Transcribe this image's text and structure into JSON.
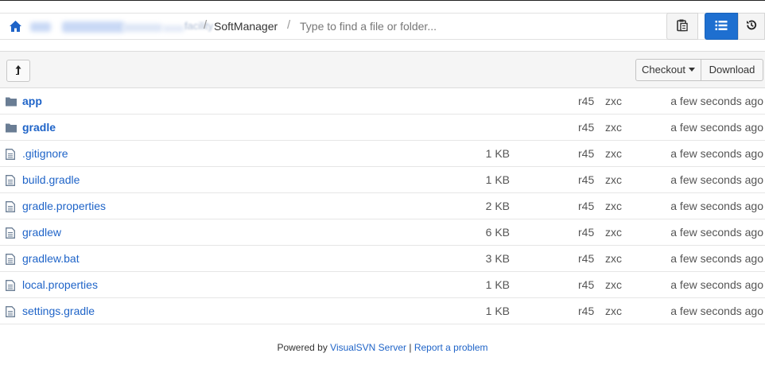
{
  "pathbar": {
    "breadcrumb_blurred": "facility",
    "separator": "/",
    "current": "SoftManager",
    "search_placeholder": "Type to find a file or folder..."
  },
  "toolbar": {
    "up_icon": "arrow-up-icon",
    "checkout_label": "Checkout",
    "download_label": "Download"
  },
  "files": [
    {
      "type": "dir",
      "name": "app",
      "size": "",
      "rev": "r45",
      "author": "zxc",
      "date": "a few seconds ago"
    },
    {
      "type": "dir",
      "name": "gradle",
      "size": "",
      "rev": "r45",
      "author": "zxc",
      "date": "a few seconds ago"
    },
    {
      "type": "file",
      "name": ".gitignore",
      "size": "1 KB",
      "rev": "r45",
      "author": "zxc",
      "date": "a few seconds ago"
    },
    {
      "type": "file",
      "name": "build.gradle",
      "size": "1 KB",
      "rev": "r45",
      "author": "zxc",
      "date": "a few seconds ago"
    },
    {
      "type": "file",
      "name": "gradle.properties",
      "size": "2 KB",
      "rev": "r45",
      "author": "zxc",
      "date": "a few seconds ago"
    },
    {
      "type": "file",
      "name": "gradlew",
      "size": "6 KB",
      "rev": "r45",
      "author": "zxc",
      "date": "a few seconds ago"
    },
    {
      "type": "file",
      "name": "gradlew.bat",
      "size": "3 KB",
      "rev": "r45",
      "author": "zxc",
      "date": "a few seconds ago"
    },
    {
      "type": "file",
      "name": "local.properties",
      "size": "1 KB",
      "rev": "r45",
      "author": "zxc",
      "date": "a few seconds ago"
    },
    {
      "type": "file",
      "name": "settings.gradle",
      "size": "1 KB",
      "rev": "r45",
      "author": "zxc",
      "date": "a few seconds ago"
    }
  ],
  "footer": {
    "powered_by": "Powered by",
    "server_link": "VisualSVN Server",
    "divider": "|",
    "report_link": "Report a problem"
  },
  "colors": {
    "link": "#1f64c8",
    "primary_button": "#1e6fd0",
    "folder": "#6a7d94"
  }
}
